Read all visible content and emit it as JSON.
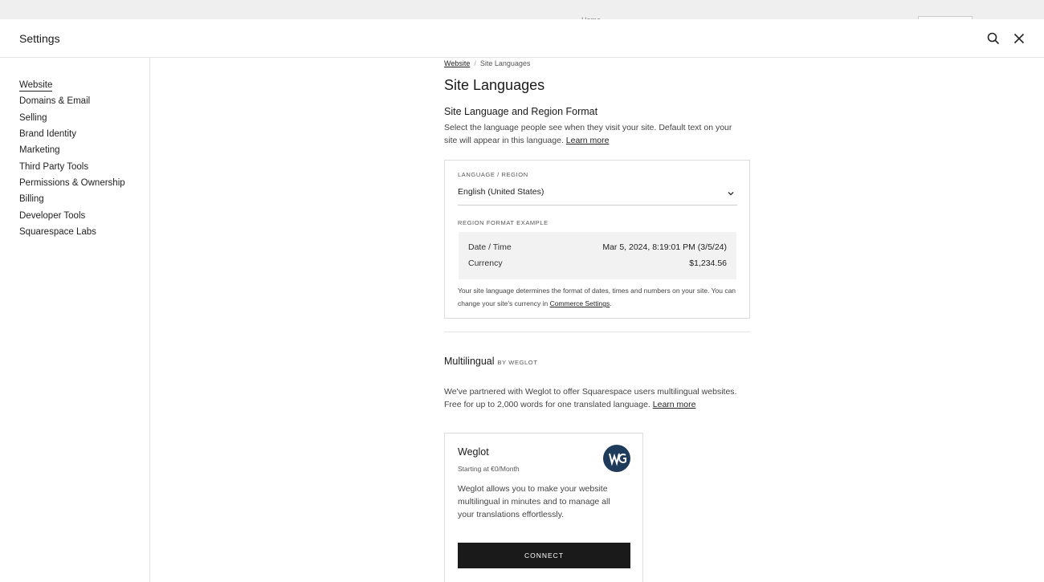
{
  "background": {
    "home_label": "Home"
  },
  "panel": {
    "title": "Settings",
    "search_icon": "search-icon",
    "close_icon": "close-icon"
  },
  "sidebar": {
    "items": [
      {
        "label": "Website",
        "active": true
      },
      {
        "label": "Domains & Email"
      },
      {
        "label": "Selling"
      },
      {
        "label": "Brand Identity"
      },
      {
        "label": "Marketing"
      },
      {
        "label": "Third Party Tools"
      },
      {
        "label": "Permissions & Ownership"
      },
      {
        "label": "Billing"
      },
      {
        "label": "Developer Tools"
      },
      {
        "label": "Squarespace Labs"
      }
    ]
  },
  "breadcrumb": {
    "parent": "Website",
    "separator": "/",
    "current": "Site Languages"
  },
  "page": {
    "title": "Site Languages",
    "section_title": "Site Language and Region Format",
    "description": "Select the language people see when they visit your site. Default text on your site will appear in this language.",
    "learn_more": "Learn more"
  },
  "language_card": {
    "language_label": "Language / Region",
    "language_value": "English (United States)",
    "chevron_icon": "chevron-down-icon",
    "example_label": "Region Format Example",
    "rows": [
      {
        "label": "Date / Time",
        "value": "Mar 5, 2024, 8:19:01 PM (3/5/24)"
      },
      {
        "label": "Currency",
        "value": "$1,234.56"
      }
    ],
    "note": "Your site language determines the format of dates, times and numbers on your site. You can change your site's currency in",
    "note_link": "Commerce Settings",
    "note_end": "."
  },
  "multilingual": {
    "title": "Multilingual",
    "by": "by Weglot",
    "description": "We've partnered with Weglot to offer Squarespace users multilingual websites. Free for up to 2,000 words for one translated language.",
    "learn_more": "Learn more"
  },
  "weglot_card": {
    "name": "Weglot",
    "price": "Starting at €0/Month",
    "description": "Weglot allows you to make your website multilingual in minutes and to manage all your translations effortlessly.",
    "button": "Connect",
    "logo_icon": "weglot-logo-icon",
    "logo_color": "#1f3b5c"
  }
}
